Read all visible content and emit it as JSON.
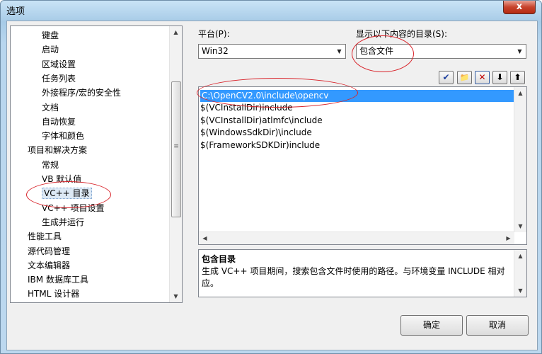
{
  "window": {
    "title": "选项",
    "close_glyph": "x"
  },
  "tree": {
    "items": [
      {
        "label": "键盘",
        "level": 2
      },
      {
        "label": "启动",
        "level": 2
      },
      {
        "label": "区域设置",
        "level": 2
      },
      {
        "label": "任务列表",
        "level": 2
      },
      {
        "label": "外接程序/宏的安全性",
        "level": 2
      },
      {
        "label": "文档",
        "level": 2
      },
      {
        "label": "自动恢复",
        "level": 2
      },
      {
        "label": "字体和颜色",
        "level": 2
      },
      {
        "label": "项目和解决方案",
        "level": 1
      },
      {
        "label": "常规",
        "level": 2
      },
      {
        "label": "VB 默认值",
        "level": 2
      },
      {
        "label": "VC++ 目录",
        "level": 2,
        "selected": true
      },
      {
        "label": "VC++ 项目设置",
        "level": 2
      },
      {
        "label": "生成并运行",
        "level": 2
      },
      {
        "label": "性能工具",
        "level": 1
      },
      {
        "label": "源代码管理",
        "level": 1
      },
      {
        "label": "文本编辑器",
        "level": 1
      },
      {
        "label": "IBM 数据库工具",
        "level": 1
      },
      {
        "label": "HTML 设计器",
        "level": 1
      }
    ]
  },
  "platform": {
    "label": "平台(P):",
    "value": "Win32"
  },
  "show_dirs": {
    "label": "显示以下内容的目录(S):",
    "value": "包含文件"
  },
  "toolbar": {
    "check": "✔",
    "folder": "📁",
    "delete": "✕",
    "down": "⬇",
    "up": "⬆"
  },
  "directories": [
    "C:\\OpenCV2.0\\include\\opencv",
    "$(VCInstallDir)include",
    "$(VCInstallDir)atlmfc\\include",
    "$(WindowsSdkDir)\\include",
    "$(FrameworkSDKDir)include"
  ],
  "description": {
    "title": "包含目录",
    "text": "生成 VC++ 项目期间，搜索包含文件时使用的路径。与环境变量 INCLUDE 相对应。"
  },
  "buttons": {
    "ok": "确定",
    "cancel": "取消"
  },
  "colors": {
    "annotation": "#d8232a",
    "selection": "#3399ff"
  }
}
